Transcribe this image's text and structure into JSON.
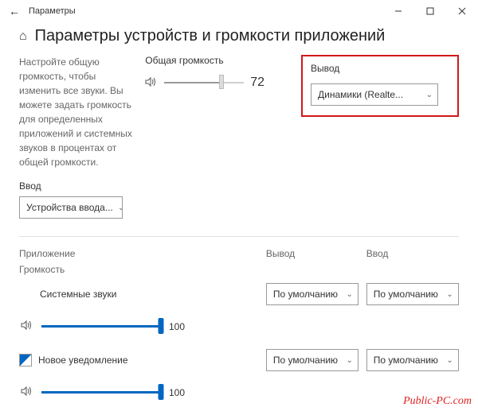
{
  "window": {
    "title": "Параметры"
  },
  "page": {
    "heading": "Параметры устройств и громкости приложений",
    "description": "Настройте общую громкость, чтобы изменить все звуки. Вы можете задать громкость для определенных приложений и системных звуков в процентах от общей громкости."
  },
  "master": {
    "label": "Общая громкость",
    "value": "72",
    "percent": 72
  },
  "output": {
    "label": "Вывод",
    "selected": "Динамики (Realte..."
  },
  "input": {
    "label": "Ввод",
    "selected": "Устройства ввода..."
  },
  "columns": {
    "app": "Приложение",
    "vol": "Громкость",
    "out": "Вывод",
    "in": "Ввод"
  },
  "default_option": "По умолчанию",
  "apps": {
    "system": {
      "name": "Системные звуки",
      "volume": "100",
      "percent": 100
    },
    "notif": {
      "name": "Новое уведомление",
      "volume": "100",
      "percent": 100
    }
  },
  "watermark": "Public-PC.com"
}
